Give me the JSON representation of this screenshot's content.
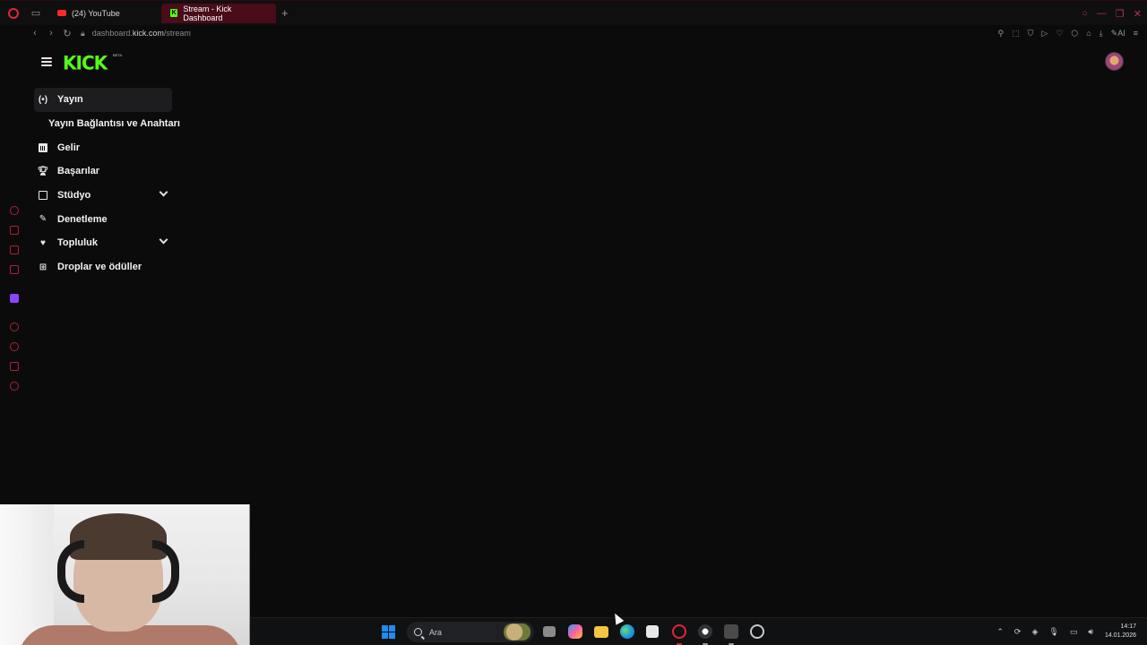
{
  "browser": {
    "tabs": [
      {
        "label": "(24) YouTube",
        "favicon": "youtube-icon",
        "active": false
      },
      {
        "label": "Stream - Kick Dashboard",
        "favicon": "kick-icon",
        "active": true
      }
    ],
    "new_tab": "+",
    "url_prefix": "dashboard.",
    "url_domain": "kick.com",
    "url_path": "/stream",
    "ai_label": "AI"
  },
  "header": {
    "logo": "KICK",
    "logo_badge": "BETA"
  },
  "nav": {
    "items": [
      {
        "label": "Yayın",
        "icon": "broadcast-icon",
        "active": true
      },
      {
        "label": "Yayın Bağlantısı ve Anahtarı",
        "sub": true
      },
      {
        "label": "Gelir",
        "icon": "chart-icon"
      },
      {
        "label": "Başarılar",
        "icon": "trophy-icon"
      },
      {
        "label": "Stüdyo",
        "icon": "studio-icon",
        "expandable": true
      },
      {
        "label": "Denetleme",
        "icon": "wrench-icon"
      },
      {
        "label": "Topluluk",
        "icon": "community-icon",
        "expandable": true
      },
      {
        "label": "Droplar ve ödüller",
        "icon": "drops-icon"
      }
    ]
  },
  "taskbar": {
    "search_placeholder": "Ara",
    "time": "14:17",
    "date": "14.01.2026"
  },
  "colors": {
    "kick_green": "#53fc18",
    "opera_red": "#e0263a",
    "active_tab": "#4a0c18",
    "background": "#0b0b0c"
  }
}
